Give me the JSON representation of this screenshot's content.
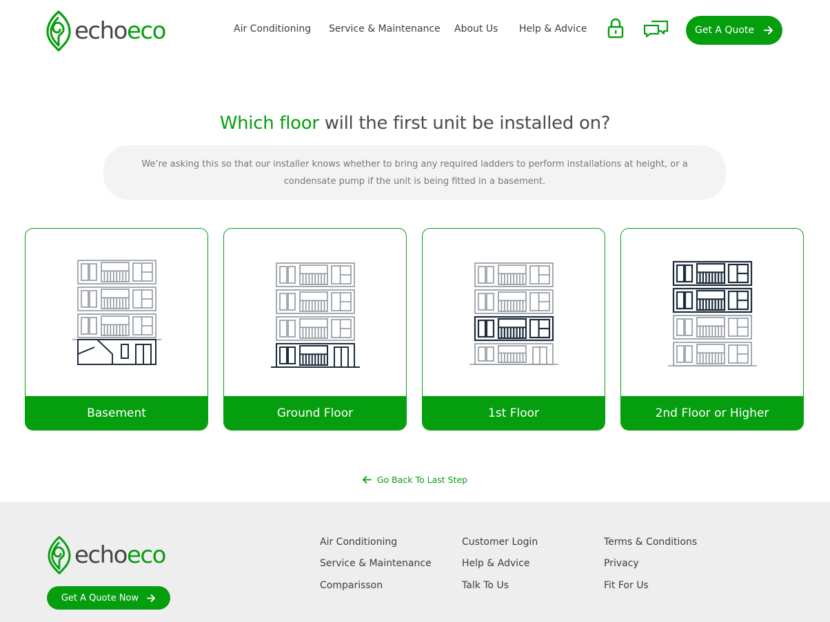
{
  "brand": {
    "name_part1": "echo",
    "name_part2": "eco",
    "color_primary": "#059e0f",
    "color_text": "#444444"
  },
  "header": {
    "nav": [
      {
        "label": "Air Conditioning"
      },
      {
        "label": "Service & Maintenance"
      },
      {
        "label": "About Us"
      },
      {
        "label": "Help & Advice"
      }
    ],
    "icons": [
      "lock-icon",
      "chat-bubbles-icon"
    ],
    "cta_label": "Get A Quote"
  },
  "question": {
    "title_accent": "Which floor",
    "title_rest": " will the first unit be installed on?",
    "info": "We’re asking this so that our installer knows whether to bring any required ladders to perform installations at height, or a condensate pump if the unit is being fitted in a basement."
  },
  "options": [
    {
      "label": "Basement",
      "icon": "building-basement-icon"
    },
    {
      "label": "Ground Floor",
      "icon": "building-ground-floor-icon"
    },
    {
      "label": "1st Floor",
      "icon": "building-first-floor-icon"
    },
    {
      "label": "2nd Floor or Higher",
      "icon": "building-upper-floors-icon"
    }
  ],
  "back_link": {
    "label": "Go Back To Last Step"
  },
  "footer": {
    "cta_label": "Get A Quote Now",
    "columns": [
      [
        "Air Conditioning",
        "Service & Maintenance",
        "Comparisson"
      ],
      [
        "Customer Login",
        "Help & Advice",
        "Talk To Us"
      ],
      [
        "Terms & Conditions",
        "Privacy",
        "Fit For Us"
      ]
    ]
  }
}
